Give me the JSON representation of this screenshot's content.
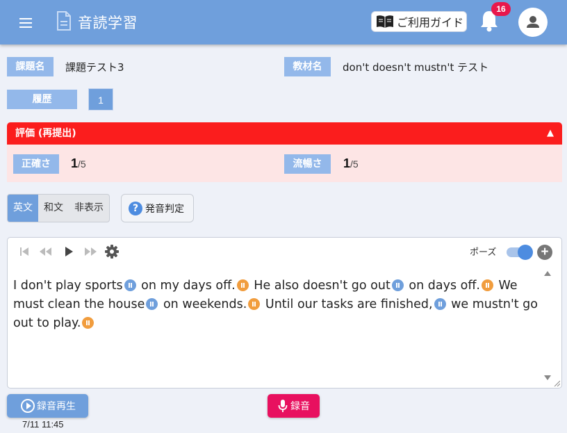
{
  "header": {
    "app_title": "音読学習",
    "guide_label": "ご利用ガイド",
    "notification_count": "16",
    "colors": {
      "bar": "#6f9fdc",
      "badge": "#e8174c"
    }
  },
  "task": {
    "task_name_label": "課題名",
    "task_name_value": "課題テスト3",
    "material_label": "教材名",
    "material_value": "don't doesn't mustn't テスト",
    "history_label": "履歴",
    "history_value": "1"
  },
  "evaluation": {
    "title": "評価 (再提出)",
    "accuracy_label": "正確さ",
    "accuracy_score": "1",
    "accuracy_max": "/5",
    "fluency_label": "流暢さ",
    "fluency_score": "1",
    "fluency_max": "/5",
    "colors": {
      "header": "#fb1d1d",
      "body": "#fde5e5"
    }
  },
  "display_mode": {
    "options": [
      "英文",
      "和文",
      "非表示"
    ],
    "selected": "英文"
  },
  "pronunciation_button": "発音判定",
  "player": {
    "pause_label": "ポーズ",
    "pause_toggle_on": true,
    "segments": [
      {
        "text": "I don't play sports",
        "mark": "blue"
      },
      {
        "text": "on my days off.",
        "mark": "orange"
      },
      {
        "text": "He also doesn't go out",
        "mark": "blue"
      },
      {
        "text": "on days off.",
        "mark": "orange"
      },
      {
        "text": "We must clean the house",
        "mark": "blue"
      },
      {
        "text": "on weekends.",
        "mark": "orange"
      },
      {
        "text": "Until our tasks are finished,",
        "mark": "blue"
      },
      {
        "text": "we mustn't go out to play.",
        "mark": "orange"
      }
    ]
  },
  "recording": {
    "play_label": "録音再生",
    "timestamp": "7/11 11:45",
    "record_label": "録音"
  }
}
